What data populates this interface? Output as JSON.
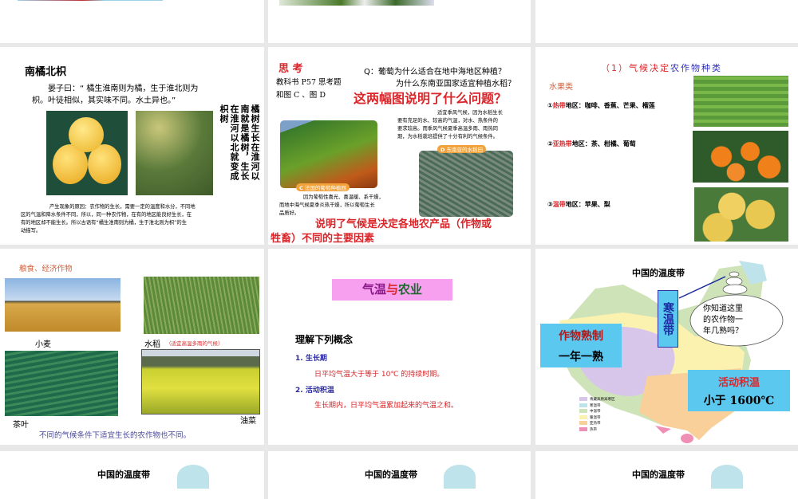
{
  "slides": [
    {
      "id": "s-top-1"
    },
    {
      "id": "s-top-2"
    },
    {
      "id": "s-top-3"
    },
    {
      "title": "南橘北枳",
      "quote": [
        "晏子曰：“ 橘生淮南则为橘，生于淮北则为",
        "枳。叶徒相似，其实味不同。水土异也。”"
      ],
      "vertical_text": [
        "橘树生长在淮河以",
        "南就是橘树，生长",
        "在淮河以北就变成",
        "枳树"
      ],
      "explanation": [
        "产生现象的原因：农作物的生长，需要一定的温度和水分，不同地",
        "区的气温和降水条件不同，所以，同一种农作物，在有的地区能良好生长，在",
        "有的地区却不能生长。所以古语有“橘生淮南则为橘，生于淮北则为枳”的生",
        "动描写。"
      ]
    },
    {
      "heading": "思 考",
      "ref": [
        "教科书 P57 思考题",
        "和图 C 、图 D"
      ],
      "question": [
        "Q：葡萄为什么适合在地中海地区种植？",
        "为什么东南亚国家适宜种植水稻？"
      ],
      "big_question": "这两幅图说明了什么问题？",
      "rice_text": [
        "适宜季风气候，因为水稻生长",
        "要有充足的水、较高的气温，对水、热条件的",
        "要求较高。而季风气候夏季高温多雨、雨热同",
        "期，为水稻栽培提供了十分有利的气候条件。"
      ],
      "label_c_letter": "C",
      "label_c": "法国的葡萄种植园",
      "label_d_letter": "D",
      "label_d": "东南亚的水稻田",
      "grape_text": [
        "因为葡萄性喜光、喜温暖、系干燥，",
        "而地中海气候夏季炎热干燥，所以葡萄生长",
        "品质好。"
      ],
      "conclusion": [
        "说明了气候是决定各地农产品（作物或",
        "牲畜）不同的主要因素"
      ]
    },
    {
      "title_prefix": "（1）气候决定",
      "title_highlight": "农作物种类",
      "category": "水果类",
      "items": [
        {
          "num": "①",
          "zone": "热带",
          "rest": "地区：咖啡、香蕉、芒果、榴莲"
        },
        {
          "num": "②",
          "zone": "亚热带",
          "rest": "地区：茶、柑橘、葡萄"
        },
        {
          "num": "③",
          "zone": "温带",
          "rest": "地区：苹果、梨"
        }
      ]
    },
    {
      "category": "粮食、经济作物",
      "labels": {
        "wheat": "小麦",
        "rice": "水稻",
        "rice_note": "（适宜高温多雨的气候）",
        "tea": "茶叶",
        "rape": "油菜"
      },
      "footer": "不同的气候条件下适宜生长的农作物也不同。"
    },
    {
      "banner_a": "气温",
      "banner_b": "与",
      "banner_c": "农业",
      "heading": "理解下列概念",
      "concepts": [
        {
          "term": "1. 生长期",
          "def": "日平均气温大于等于 10℃ 的持续时期。"
        },
        {
          "term": "2. 活动积温",
          "def": "生长期内，日平均气温累加起来的气温之和。"
        }
      ]
    },
    {
      "title": "中国的温度带",
      "zone_label": "寒温带",
      "thought": [
        "你知道这里",
        "的农作物一",
        "年几熟吗？"
      ],
      "box1": [
        "作物熟制",
        "一年一熟"
      ],
      "box2": [
        "活动积温",
        "小于 1600℃"
      ],
      "legend": [
        "青藏高原高寒区",
        "寒温带",
        "中温带",
        "暖温带",
        "亚热带",
        "热带"
      ],
      "legend_colors": [
        "#d7c6ea",
        "#bfe3ea",
        "#cfe3b8",
        "#fbf2b0",
        "#f9cf9a",
        "#ef8fb6"
      ]
    },
    {
      "title": "中国的温度带"
    },
    {
      "title": "中国的温度带"
    },
    {
      "title": "中国的温度带"
    }
  ]
}
